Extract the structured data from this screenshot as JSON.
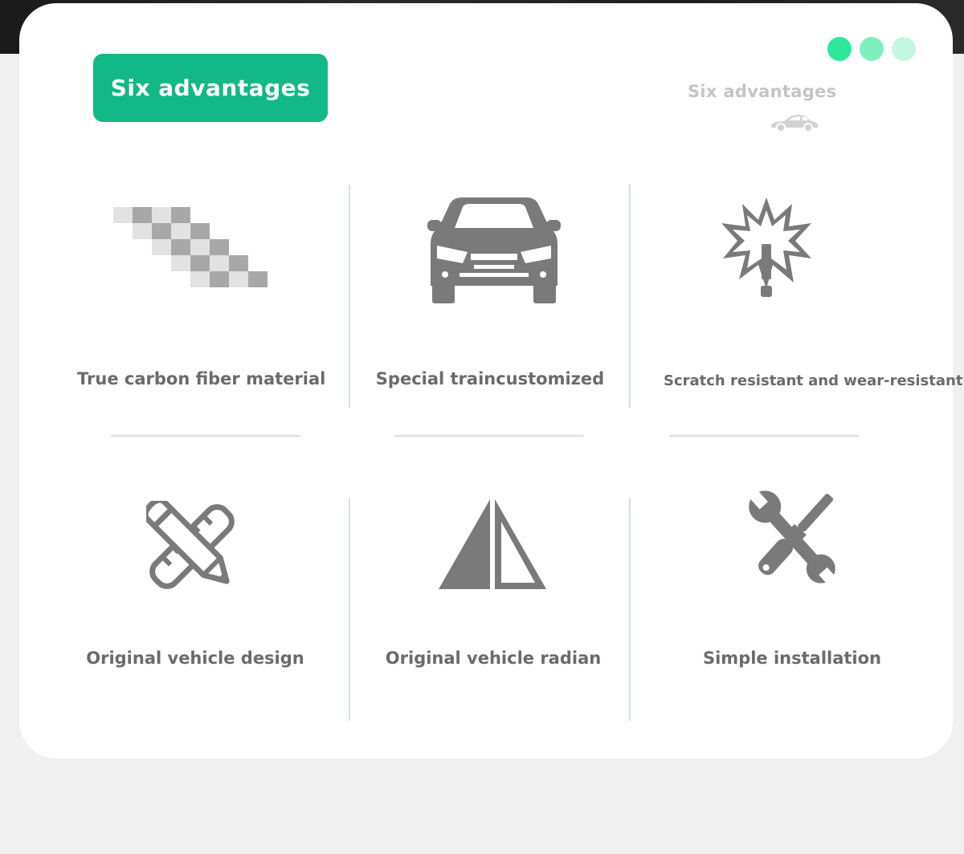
{
  "header": {
    "title": "Six advantages",
    "subtitle": "Six advantages"
  },
  "icons": {
    "carbon": "checker-pattern-icon",
    "car": "car-front-icon",
    "scratch": "warning-burst-icon",
    "design": "pencil-ruler-icon",
    "radian": "triangle-icon",
    "install": "wrench-screwdriver-icon",
    "small_car": "car-side-icon"
  },
  "colors": {
    "accent": "#12b886",
    "icon": "#7a7a7a",
    "text": "#6b6b6b"
  },
  "advantages": [
    {
      "label": "True carbon fiber material"
    },
    {
      "label": "Special traincustomized"
    },
    {
      "label": "Scratch resistant and wear-resistant"
    },
    {
      "label": "Original vehicle design"
    },
    {
      "label": "Original vehicle radian"
    },
    {
      "label": "Simple installation"
    }
  ]
}
